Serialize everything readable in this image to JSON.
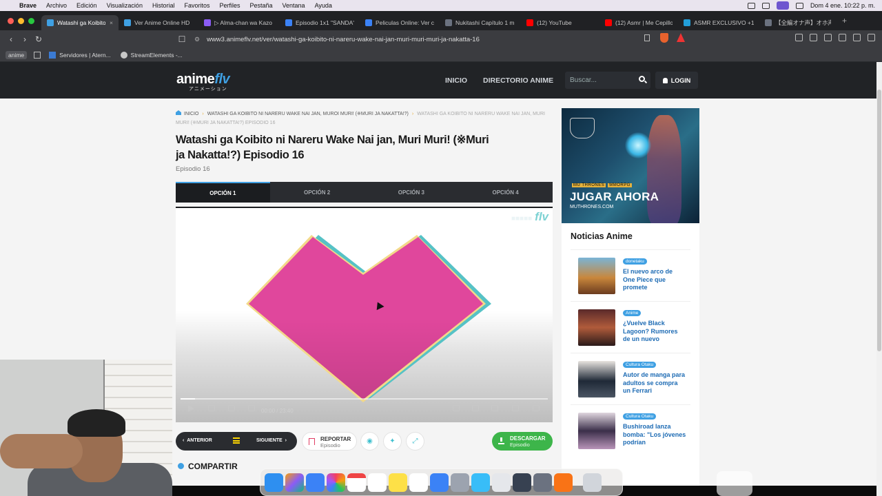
{
  "menubar": {
    "app": "Brave",
    "items": [
      "Archivo",
      "Edición",
      "Visualización",
      "Historial",
      "Favoritos",
      "Perfiles",
      "Pestaña",
      "Ventana",
      "Ayuda"
    ],
    "clock": "Dom 4 ene.  10:22 p. m."
  },
  "tabs": [
    {
      "label": "Watashi ga Koibito",
      "active": true,
      "favicon_color": "#3fa0e3"
    },
    {
      "label": "Ver Anime Online HD",
      "active": false,
      "favicon_color": "#3fa0e3"
    },
    {
      "label": "▷ Alma-chan wa Kazo",
      "active": false,
      "favicon_color": "#8b5cf6"
    },
    {
      "label": "Episodio 1x1 \"SANDA\"",
      "active": false,
      "favicon_color": "#3b82f6"
    },
    {
      "label": "Peliculas Online: Ver c",
      "active": false,
      "favicon_color": "#3b82f6"
    },
    {
      "label": "Nukitashi Capítulo 1 m",
      "active": false,
      "favicon_color": "#6b7280"
    },
    {
      "label": "(12) YouTube",
      "active": false,
      "favicon_color": "#ff0000"
    },
    {
      "label": "(12) Asmr | Me Cepillo",
      "active": false,
      "favicon_color": "#ff0000"
    },
    {
      "label": "ASMR EXCLUSIVO +1",
      "active": false,
      "favicon_color": "#229ed9"
    },
    {
      "label": "【全編オナ声】オホ声",
      "active": false,
      "favicon_color": "#6b7280"
    }
  ],
  "addressbar": {
    "url": "www3.animeflv.net/ver/watashi-ga-koibito-ni-nareru-wake-nai-jan-muri-muri-muri-ja-nakatta-16"
  },
  "bookmarks": [
    "anime",
    "Servidores | Atern...",
    "StreamElements -..."
  ],
  "site": {
    "logo_main": "anime",
    "logo_accent": "flv",
    "logo_sub": "アニメーション",
    "nav": [
      "INICIO",
      "DIRECTORIO ANIME"
    ],
    "search_placeholder": "Buscar...",
    "login": "LOGIN"
  },
  "breadcrumb": {
    "home": "INICIO",
    "series": "WATASHI GA KOIBITO NI NARERU WAKE NAI JAN, MUROI MURI! (※MURI JA NAKATTA!?)",
    "current": "WATASHI GA KOIBITO NI NARERU WAKE NAI JAN, MURI MURI! (※MURI JA NAKATTA!?) EPISODIO 16"
  },
  "episode": {
    "title": "Watashi ga Koibito ni Nareru Wake Nai jan, Muri Muri! (※Muri ja Nakatta!?) Episodio 16",
    "subtitle": "Episodio 16"
  },
  "options": [
    "OPCIÓN 1",
    "OPCIÓN 2",
    "OPCIÓN 3",
    "OPCIÓN 4"
  ],
  "player": {
    "watermark": "flv",
    "time": "00:00 / 23:40",
    "progress": 0.04
  },
  "actions": {
    "prev": "ANTERIOR",
    "next": "SIGUIENTE",
    "report": "REPORTAR",
    "report_sub": "Episodio",
    "download": "DESCARGAR",
    "download_sub": "Episodio",
    "share": "COMPARTIR"
  },
  "ad": {
    "brand": "MU THRONES",
    "badge": "MMORPG",
    "cta": "JUGAR AHORA",
    "site": "MUTHRONES.COM"
  },
  "news": {
    "title": "Noticias Anime",
    "items": [
      {
        "tag": "donetaku",
        "headline": "El nuevo arco de One Piece que promete"
      },
      {
        "tag": "Anime",
        "headline": "¿Vuelve Black Lagoon? Rumores de un nuevo"
      },
      {
        "tag": "Cultura Otaku",
        "headline": "Autor de manga para adultos se compra un Ferrari"
      },
      {
        "tag": "Cultura Otaku",
        "headline": "Bushiroad lanza bomba: \"Los jóvenes podrían"
      }
    ]
  },
  "colors": {
    "accent": "#3fa0e3",
    "download": "#3db54a",
    "heart_pink": "#e0479c",
    "heart_teal": "#56c2c6"
  },
  "icons": [
    "apple-icon",
    "search-icon",
    "user-icon",
    "flag-icon",
    "eye-icon",
    "bulb-icon",
    "expand-icon",
    "download-icon",
    "list-icon",
    "home-icon"
  ]
}
